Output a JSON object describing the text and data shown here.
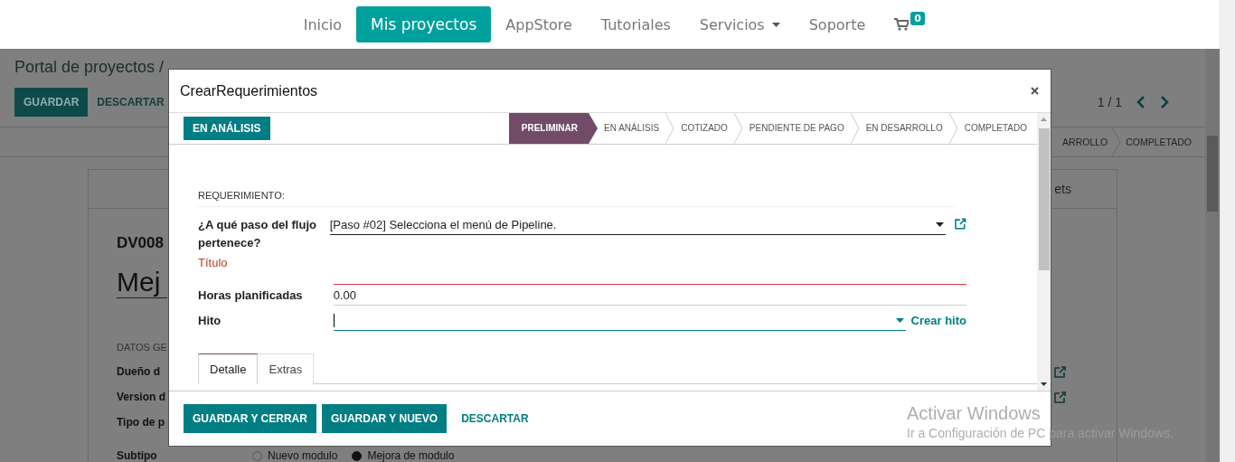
{
  "nav": {
    "items": [
      {
        "label": "Inicio",
        "selected": false,
        "dropdown": false
      },
      {
        "label": "Mis proyectos",
        "selected": true,
        "dropdown": false
      },
      {
        "label": "AppStore",
        "selected": false,
        "dropdown": false
      },
      {
        "label": "Tutoriales",
        "selected": false,
        "dropdown": false
      },
      {
        "label": "Servicios",
        "selected": false,
        "dropdown": true
      },
      {
        "label": "Soporte",
        "selected": false,
        "dropdown": false
      }
    ],
    "cart_count": "0"
  },
  "background_form": {
    "breadcrumb": "Portal de proyectos /",
    "buttons": [
      "GUARDAR",
      "DESCARTAR"
    ],
    "pager": "1 / 1",
    "stages": [
      "ARROLLO",
      "COMPLETADO"
    ],
    "tab": "ets",
    "code": "DV008",
    "name": "Mej",
    "section": "DATOS GE",
    "fields": [
      {
        "label": "Dueño d",
        "link": true
      },
      {
        "label": "Version d",
        "link": true
      },
      {
        "label": "Tipo de p",
        "link": false
      }
    ],
    "subtype": {
      "label": "Subtipo",
      "options": [
        {
          "label": "Nuevo modulo",
          "selected": false
        },
        {
          "label": "Mejora de modulo",
          "selected": true
        }
      ]
    }
  },
  "dialog": {
    "title": "CrearRequerimientos",
    "state_button": "EN ANÁLISIS",
    "stages": [
      {
        "label": "PRELIMINAR",
        "selected": true
      },
      {
        "label": "EN ANÁLISIS",
        "selected": false
      },
      {
        "label": "COTIZADO",
        "selected": false
      },
      {
        "label": "PENDIENTE DE PAGO",
        "selected": false
      },
      {
        "label": "EN DESARROLLO",
        "selected": false
      },
      {
        "label": "COMPLETADO",
        "selected": false
      }
    ],
    "section": "REQUERIMIENTO:",
    "fields": [
      {
        "kind": "select",
        "label": "¿A qué paso del flujo pertenece?",
        "value": "[Paso #02] Selecciona el menú de Pipeline.",
        "required": false,
        "focused": false,
        "link": true
      },
      {
        "kind": "text",
        "label": "Título",
        "required": true,
        "focused": false
      },
      {
        "kind": "text",
        "label": "Horas planificadas",
        "value": "0.00",
        "required": false,
        "focused": false
      },
      {
        "kind": "select",
        "label": "Hito",
        "required": false,
        "focused": true,
        "action": "Crear hito"
      }
    ],
    "tabs": [
      {
        "label": "Detalle",
        "selected": true
      },
      {
        "label": "Extras",
        "selected": false
      }
    ],
    "buttons": [
      {
        "label": "GUARDAR Y CERRAR",
        "kind": "primary"
      },
      {
        "label": "GUARDAR Y NUEVO",
        "kind": "primary"
      },
      {
        "label": "DESCARTAR",
        "kind": "link"
      }
    ]
  },
  "os_notice": {
    "title": "Activar Windows",
    "text": "Ir a Configuración de PC para activar Windows."
  }
}
